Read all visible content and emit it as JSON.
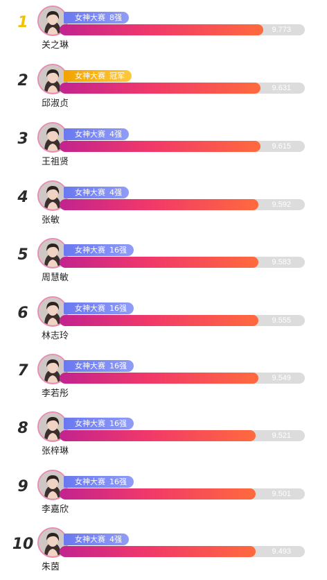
{
  "leaderboard": [
    {
      "rank": "1",
      "name": "关之琳",
      "event": "女神大赛",
      "stage": "8强",
      "score": "9.773",
      "fill": 0.83,
      "badge_style": "normal"
    },
    {
      "rank": "2",
      "name": "邱淑贞",
      "event": "女神大赛",
      "stage": "冠军",
      "score": "9.631",
      "fill": 0.82,
      "badge_style": "champion"
    },
    {
      "rank": "3",
      "name": "王祖贤",
      "event": "女神大赛",
      "stage": "4强",
      "score": "9.615",
      "fill": 0.82,
      "badge_style": "normal"
    },
    {
      "rank": "4",
      "name": "张敏",
      "event": "女神大赛",
      "stage": "4强",
      "score": "9.592",
      "fill": 0.81,
      "badge_style": "normal"
    },
    {
      "rank": "5",
      "name": "周慧敏",
      "event": "女神大赛",
      "stage": "16强",
      "score": "9.583",
      "fill": 0.81,
      "badge_style": "normal"
    },
    {
      "rank": "6",
      "name": "林志玲",
      "event": "女神大赛",
      "stage": "16强",
      "score": "9.555",
      "fill": 0.81,
      "badge_style": "normal"
    },
    {
      "rank": "7",
      "name": "李若彤",
      "event": "女神大赛",
      "stage": "16强",
      "score": "9.549",
      "fill": 0.81,
      "badge_style": "normal"
    },
    {
      "rank": "8",
      "name": "张梓琳",
      "event": "女神大赛",
      "stage": "16强",
      "score": "9.521",
      "fill": 0.8,
      "badge_style": "normal"
    },
    {
      "rank": "9",
      "name": "李嘉欣",
      "event": "女神大赛",
      "stage": "16强",
      "score": "9.501",
      "fill": 0.8,
      "badge_style": "normal"
    },
    {
      "rank": "10",
      "name": "朱茵",
      "event": "女神大赛",
      "stage": "4强",
      "score": "9.493",
      "fill": 0.8,
      "badge_style": "normal"
    }
  ],
  "colors": {
    "rank_first": "#f2c100",
    "rank_default": "#2b2b2b",
    "bar_gradient": [
      "#c2238f",
      "#f1386a",
      "#ff6a3d"
    ],
    "bar_track": "#dcdcdc",
    "badge_normal": "#7482f3",
    "badge_champion": "#f5b020",
    "avatar_ring": "#e98bb5"
  },
  "icons": {
    "avatar": "portrait-photo-icon"
  }
}
